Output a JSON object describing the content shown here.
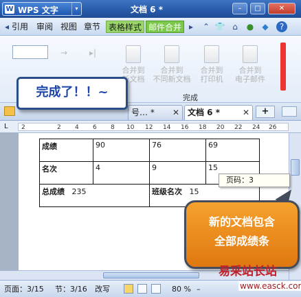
{
  "app": {
    "logo_letter": "W",
    "logo_text": "WPS 文字",
    "logo_caret": "▾",
    "doc_title": "文档 6 *"
  },
  "window_buttons": {
    "minimize": "–",
    "restore": "□",
    "close": "✕"
  },
  "menu": {
    "prev_arrow": "◂",
    "items": [
      "引用",
      "审阅",
      "视图",
      "章节",
      "表格样式",
      "邮件合并"
    ],
    "next_arrow": "▸",
    "right_icons": {
      "up": "⌃",
      "shirt": "👕",
      "home": "⌂",
      "help": "?"
    }
  },
  "ribbon": {
    "buttons": [
      "合并到\n新文档",
      "合并到\n不同新文档",
      "合并到\n打印机",
      "合并到\n电子邮件"
    ],
    "group_label": "完成",
    "left_arrows": [
      "→",
      "▸|"
    ]
  },
  "callout": {
    "text": "完成了！！~"
  },
  "doc_tabs": [
    {
      "label": "号… *",
      "close": "✕"
    },
    {
      "label": "文档 6 *",
      "close": "✕"
    }
  ],
  "tab_new": "+",
  "ruler": {
    "ticks": [
      "2",
      "2",
      "4",
      "6",
      "8",
      "10",
      "12",
      "14",
      "16",
      "18",
      "20",
      "22",
      "24",
      "26"
    ]
  },
  "table": {
    "rows": [
      [
        "成绩",
        "90",
        "76",
        "69"
      ],
      [
        "名次",
        "4",
        "9",
        "15"
      ]
    ],
    "total_label": "总成绩",
    "total_value": "235",
    "class_rank_label": "班级名次",
    "class_rank_value": "15"
  },
  "tooltip": {
    "text": "页码：3"
  },
  "bubble": {
    "line1": "新的文档包含",
    "line2": "全部成绩条"
  },
  "status": {
    "page": "页面：3/15",
    "section": "节：3/16",
    "mode": "改写",
    "zoom": "80 %",
    "zoom_minus": "–"
  },
  "watermark": {
    "site": "易采站长站",
    "url": "www.easck.com"
  }
}
